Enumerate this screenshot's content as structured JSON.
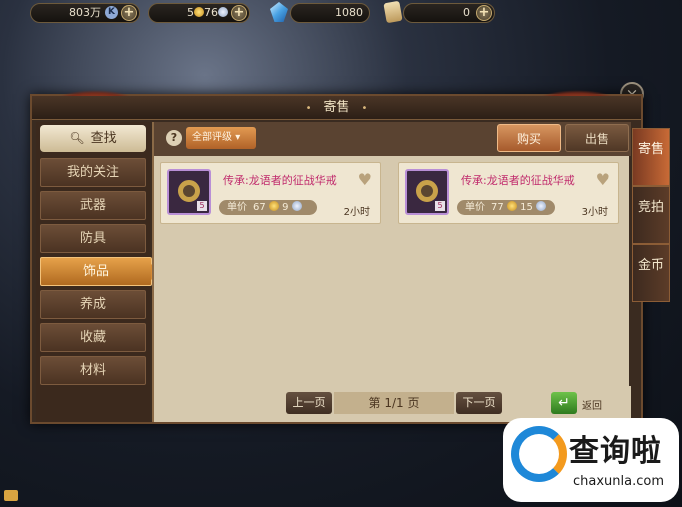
{
  "currency": {
    "money": "803万",
    "money_icon": "K",
    "coins": "5",
    "silver": "76",
    "gems": "1080",
    "scrolls": "0"
  },
  "window": {
    "title": "寄售",
    "close": "×"
  },
  "sidebar": {
    "search": "查找",
    "items": [
      {
        "label": "我的关注"
      },
      {
        "label": "武器"
      },
      {
        "label": "防具"
      },
      {
        "label": "饰品"
      },
      {
        "label": "养成"
      },
      {
        "label": "收藏"
      },
      {
        "label": "材料"
      }
    ],
    "active": "饰品"
  },
  "toolbar": {
    "help": "?",
    "filter": "全部评级",
    "buy": "购买",
    "sell": "出售"
  },
  "listings": [
    {
      "name": "传承:龙语者的征战华戒",
      "price_label": "单价",
      "gold": "67",
      "silver": "9",
      "time": "2小时",
      "level_badge": "5"
    },
    {
      "name": "传承:龙语者的征战华戒",
      "price_label": "单价",
      "gold": "77",
      "silver": "15",
      "time": "3小时",
      "level_badge": "5"
    }
  ],
  "pager": {
    "prev": "上一页",
    "info": "第 1/1 页",
    "next": "下一页",
    "back": "返回"
  },
  "side_tabs": [
    {
      "label": "寄售",
      "active": true
    },
    {
      "label": "竞拍",
      "active": false
    },
    {
      "label": "金币",
      "active": false
    }
  ],
  "watermark": {
    "brand": "查询啦",
    "url": "chaxunla.com"
  }
}
